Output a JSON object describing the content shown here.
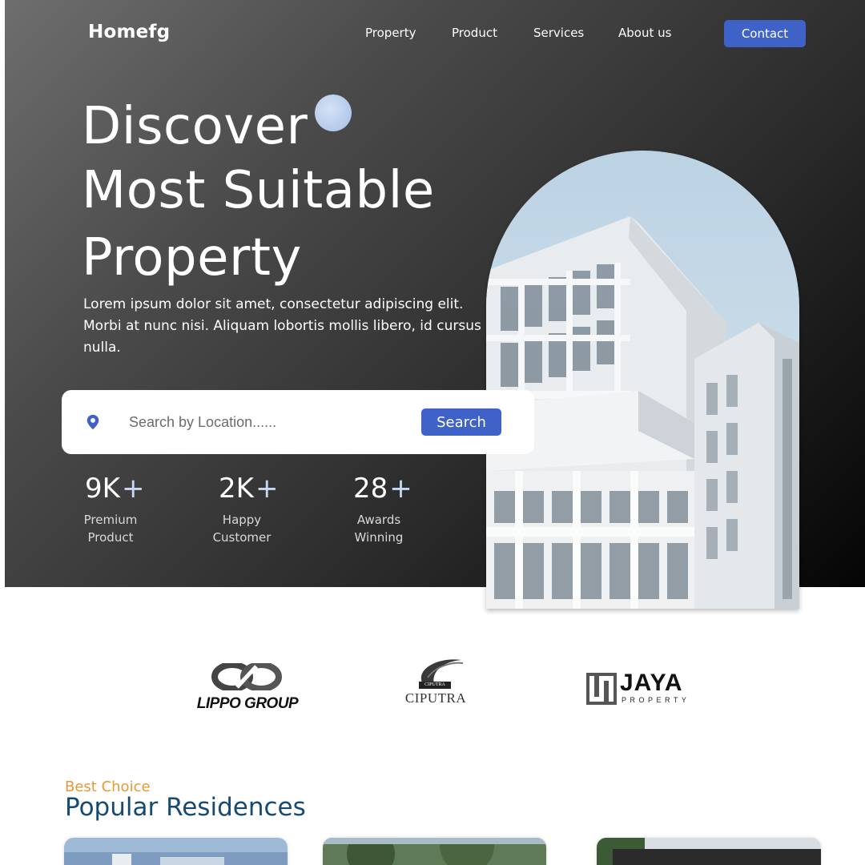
{
  "header": {
    "brand": "Homefg",
    "nav": [
      {
        "label": "Property"
      },
      {
        "label": "Product"
      },
      {
        "label": "Services"
      },
      {
        "label": "About us"
      }
    ],
    "contact_label": "Contact"
  },
  "hero": {
    "headline": [
      "Discover",
      "Most Suitable",
      "Property"
    ],
    "lead": "Lorem ipsum dolor sit amet, consectetur adipiscing elit. Morbi at nunc nisi. Aliquam lobortis mollis libero, id cursus nulla.",
    "search": {
      "placeholder": "Search by Location......",
      "button_label": "Search",
      "icon": "location-pin-icon"
    },
    "stats": [
      {
        "value": "9K",
        "suffix": "+",
        "label_line1": "Premium",
        "label_line2": "Product"
      },
      {
        "value": "2K",
        "suffix": "+",
        "label_line1": "Happy",
        "label_line2": "Customer"
      },
      {
        "value": "28",
        "suffix": "+",
        "label_line1": "Awards",
        "label_line2": "Winning"
      }
    ]
  },
  "partners": [
    {
      "name": "LIPPO GROUP"
    },
    {
      "name": "CIPUTRA",
      "badge": "CIPUTRA"
    },
    {
      "name": "JAYA",
      "subtitle": "PROPERTY"
    }
  ],
  "popular": {
    "kicker": "Best Choice",
    "title": "Popular Residences"
  },
  "colors": {
    "accent": "#3f62c9",
    "kicker": "#e39a36",
    "title": "#174a72"
  }
}
